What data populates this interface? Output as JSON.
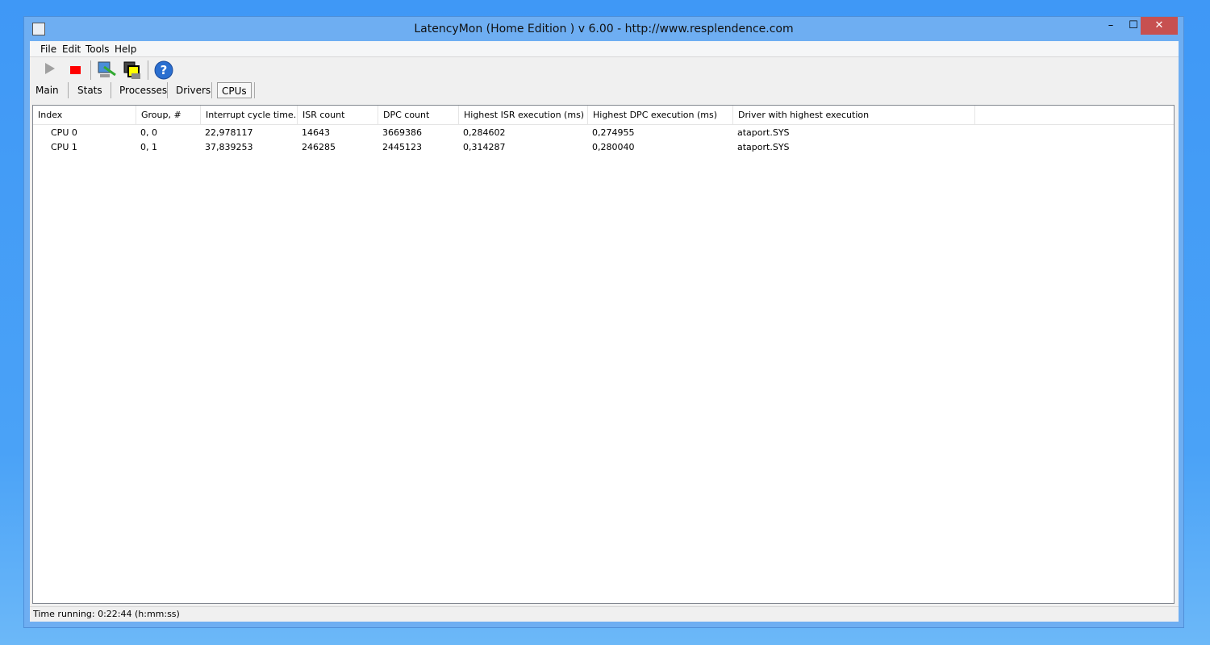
{
  "window": {
    "title": "LatencyMon  (Home Edition )  v 6.00 - http://www.resplendence.com"
  },
  "controls": {
    "minimize": "–",
    "maximize": "☐",
    "close": "✕"
  },
  "menu": [
    {
      "label": "File"
    },
    {
      "label": "Edit"
    },
    {
      "label": "Tools"
    },
    {
      "label": "Help"
    }
  ],
  "toolbar": [
    "start-icon",
    "stop-icon",
    "analyze-icon",
    "cpus-icon",
    "help-icon"
  ],
  "tabs": [
    {
      "label": "Main"
    },
    {
      "label": "Stats"
    },
    {
      "label": "Processes"
    },
    {
      "label": "Drivers"
    },
    {
      "label": "CPUs",
      "active": true
    }
  ],
  "table": {
    "columns": [
      "Index",
      "Group, #",
      "Interrupt cycle time...",
      "ISR count",
      "DPC count",
      "Highest ISR execution (ms)",
      "Highest DPC execution (ms)",
      "Driver with highest execution"
    ],
    "rows": [
      [
        "CPU 0",
        "0, 0",
        "22,978117",
        "14643",
        "3669386",
        "0,284602",
        "0,274955",
        "ataport.SYS"
      ],
      [
        "CPU 1",
        "0, 1",
        "37,839253",
        "246285",
        "2445123",
        "0,314287",
        "0,280040",
        "ataport.SYS"
      ]
    ]
  },
  "status": {
    "text": "Time running: 0:22:44  (h:mm:ss)"
  },
  "colors": {
    "titlebar": "#6eaef2",
    "close": "#c75050",
    "stop": "#ff0000"
  }
}
